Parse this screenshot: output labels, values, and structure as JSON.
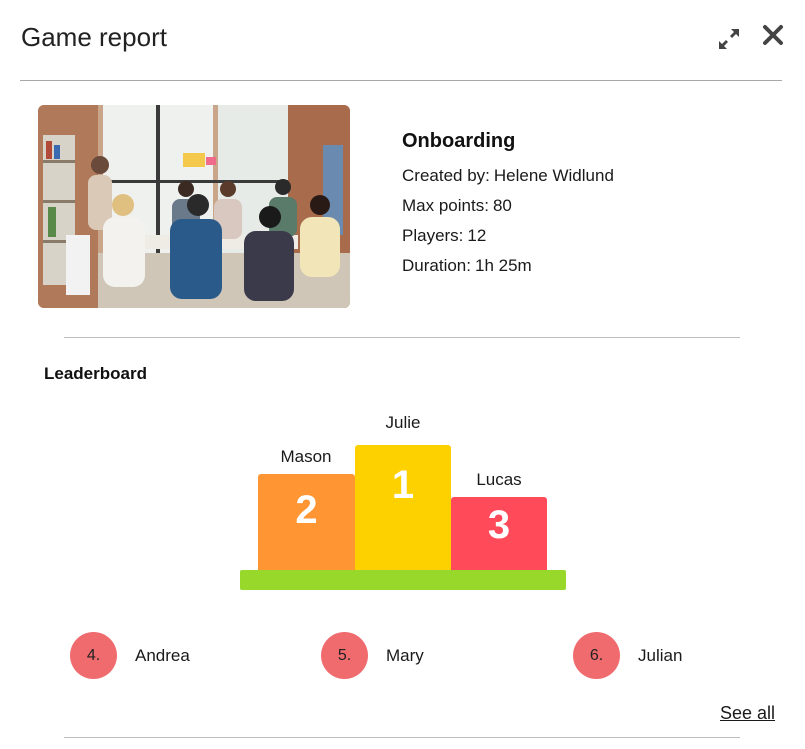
{
  "header": {
    "title": "Game report",
    "icons": {
      "expand": "expand-icon",
      "close": "close-icon"
    }
  },
  "game": {
    "name": "Onboarding",
    "created_by_label": "Created by:",
    "created_by": "Helene Widlund",
    "max_points_label": "Max points:",
    "max_points": "80",
    "players_label": "Players:",
    "players": "12",
    "duration_label": "Duration:",
    "duration": "1h 25m"
  },
  "leaderboard": {
    "title": "Leaderboard",
    "podium": [
      {
        "rank": "1",
        "name": "Julie",
        "color": "#fdd000"
      },
      {
        "rank": "2",
        "name": "Mason",
        "color": "#ff9633"
      },
      {
        "rank": "3",
        "name": "Lucas",
        "color": "#ff4a5a"
      }
    ],
    "base_color": "#97d82a",
    "others": [
      {
        "rank": "4.",
        "name": "Andrea"
      },
      {
        "rank": "5.",
        "name": "Mary"
      },
      {
        "rank": "6.",
        "name": "Julian"
      }
    ],
    "rank_color": "#ef6b6e",
    "see_all": "See all"
  }
}
